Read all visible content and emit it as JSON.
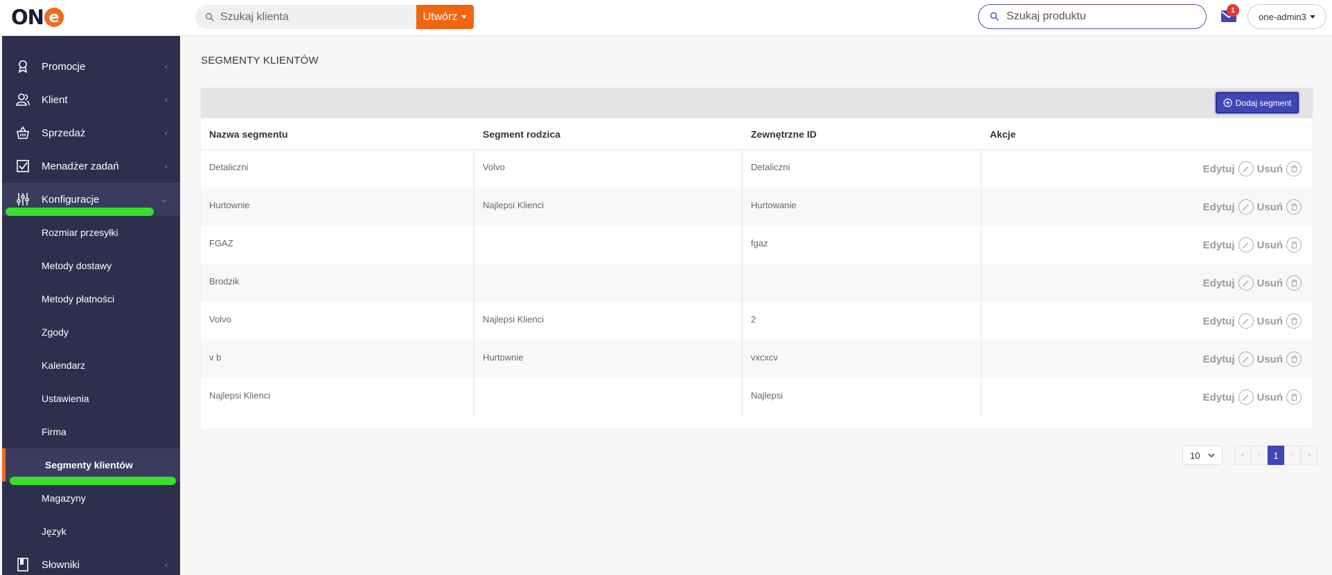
{
  "header": {
    "logo_text": "ON",
    "logo_mark": "e",
    "client_search_placeholder": "Szukaj klienta",
    "create_label": "Utwórz",
    "product_search_placeholder": "Szukaj produktu",
    "mail_badge": "1",
    "user_label": "one-admin3"
  },
  "sidebar": {
    "items": [
      {
        "label": "Promocje",
        "icon": "award-icon"
      },
      {
        "label": "Klient",
        "icon": "users-icon"
      },
      {
        "label": "Sprzedaż",
        "icon": "basket-icon"
      },
      {
        "label": "Menadżer zadań",
        "icon": "checkbox-icon"
      },
      {
        "label": "Konfiguracje",
        "icon": "sliders-icon"
      }
    ],
    "subitems": [
      "Rozmiar przesyłki",
      "Metody dostawy",
      "Metody płatności",
      "Zgody",
      "Kalendarz",
      "Ustawienia",
      "Firma",
      "Segmenty klientów",
      "Magazyny",
      "Język"
    ],
    "bottom_item": {
      "label": "Słowniki",
      "icon": "book-icon"
    }
  },
  "main": {
    "title": "SEGMENTY KLIENTÓW",
    "add_button": "Dodaj segment",
    "columns": [
      "Nazwa segmentu",
      "Segment rodzica",
      "Zewnętrzne ID",
      "Akcje"
    ],
    "rows": [
      {
        "name": "Detaliczni",
        "parent": "Volvo",
        "ext_id": "Detaliczni"
      },
      {
        "name": "Hurtownie",
        "parent": "Najlepsi Klienci",
        "ext_id": "Hurtowanie"
      },
      {
        "name": "FGAZ",
        "parent": "",
        "ext_id": "fgaz"
      },
      {
        "name": "Brodzik",
        "parent": "",
        "ext_id": ""
      },
      {
        "name": "Volvo",
        "parent": "Najlepsi Klienci",
        "ext_id": "2"
      },
      {
        "name": "v b",
        "parent": "Hurtownie",
        "ext_id": "vxcxcv"
      },
      {
        "name": "Najlepsi Klienci",
        "parent": "",
        "ext_id": "Najlepsi"
      }
    ],
    "edit_label": "Edytuj",
    "delete_label": "Usuń"
  },
  "pagination": {
    "per_page": "10",
    "current_page": "1",
    "nav": {
      "first": "«",
      "prev": "‹",
      "next": "›",
      "last": "»"
    }
  },
  "colors": {
    "accent": "#3f46b5",
    "brand_orange": "#f26a1b",
    "sidebar_bg": "#2e2e4d",
    "highlight_green": "#35e12a"
  }
}
